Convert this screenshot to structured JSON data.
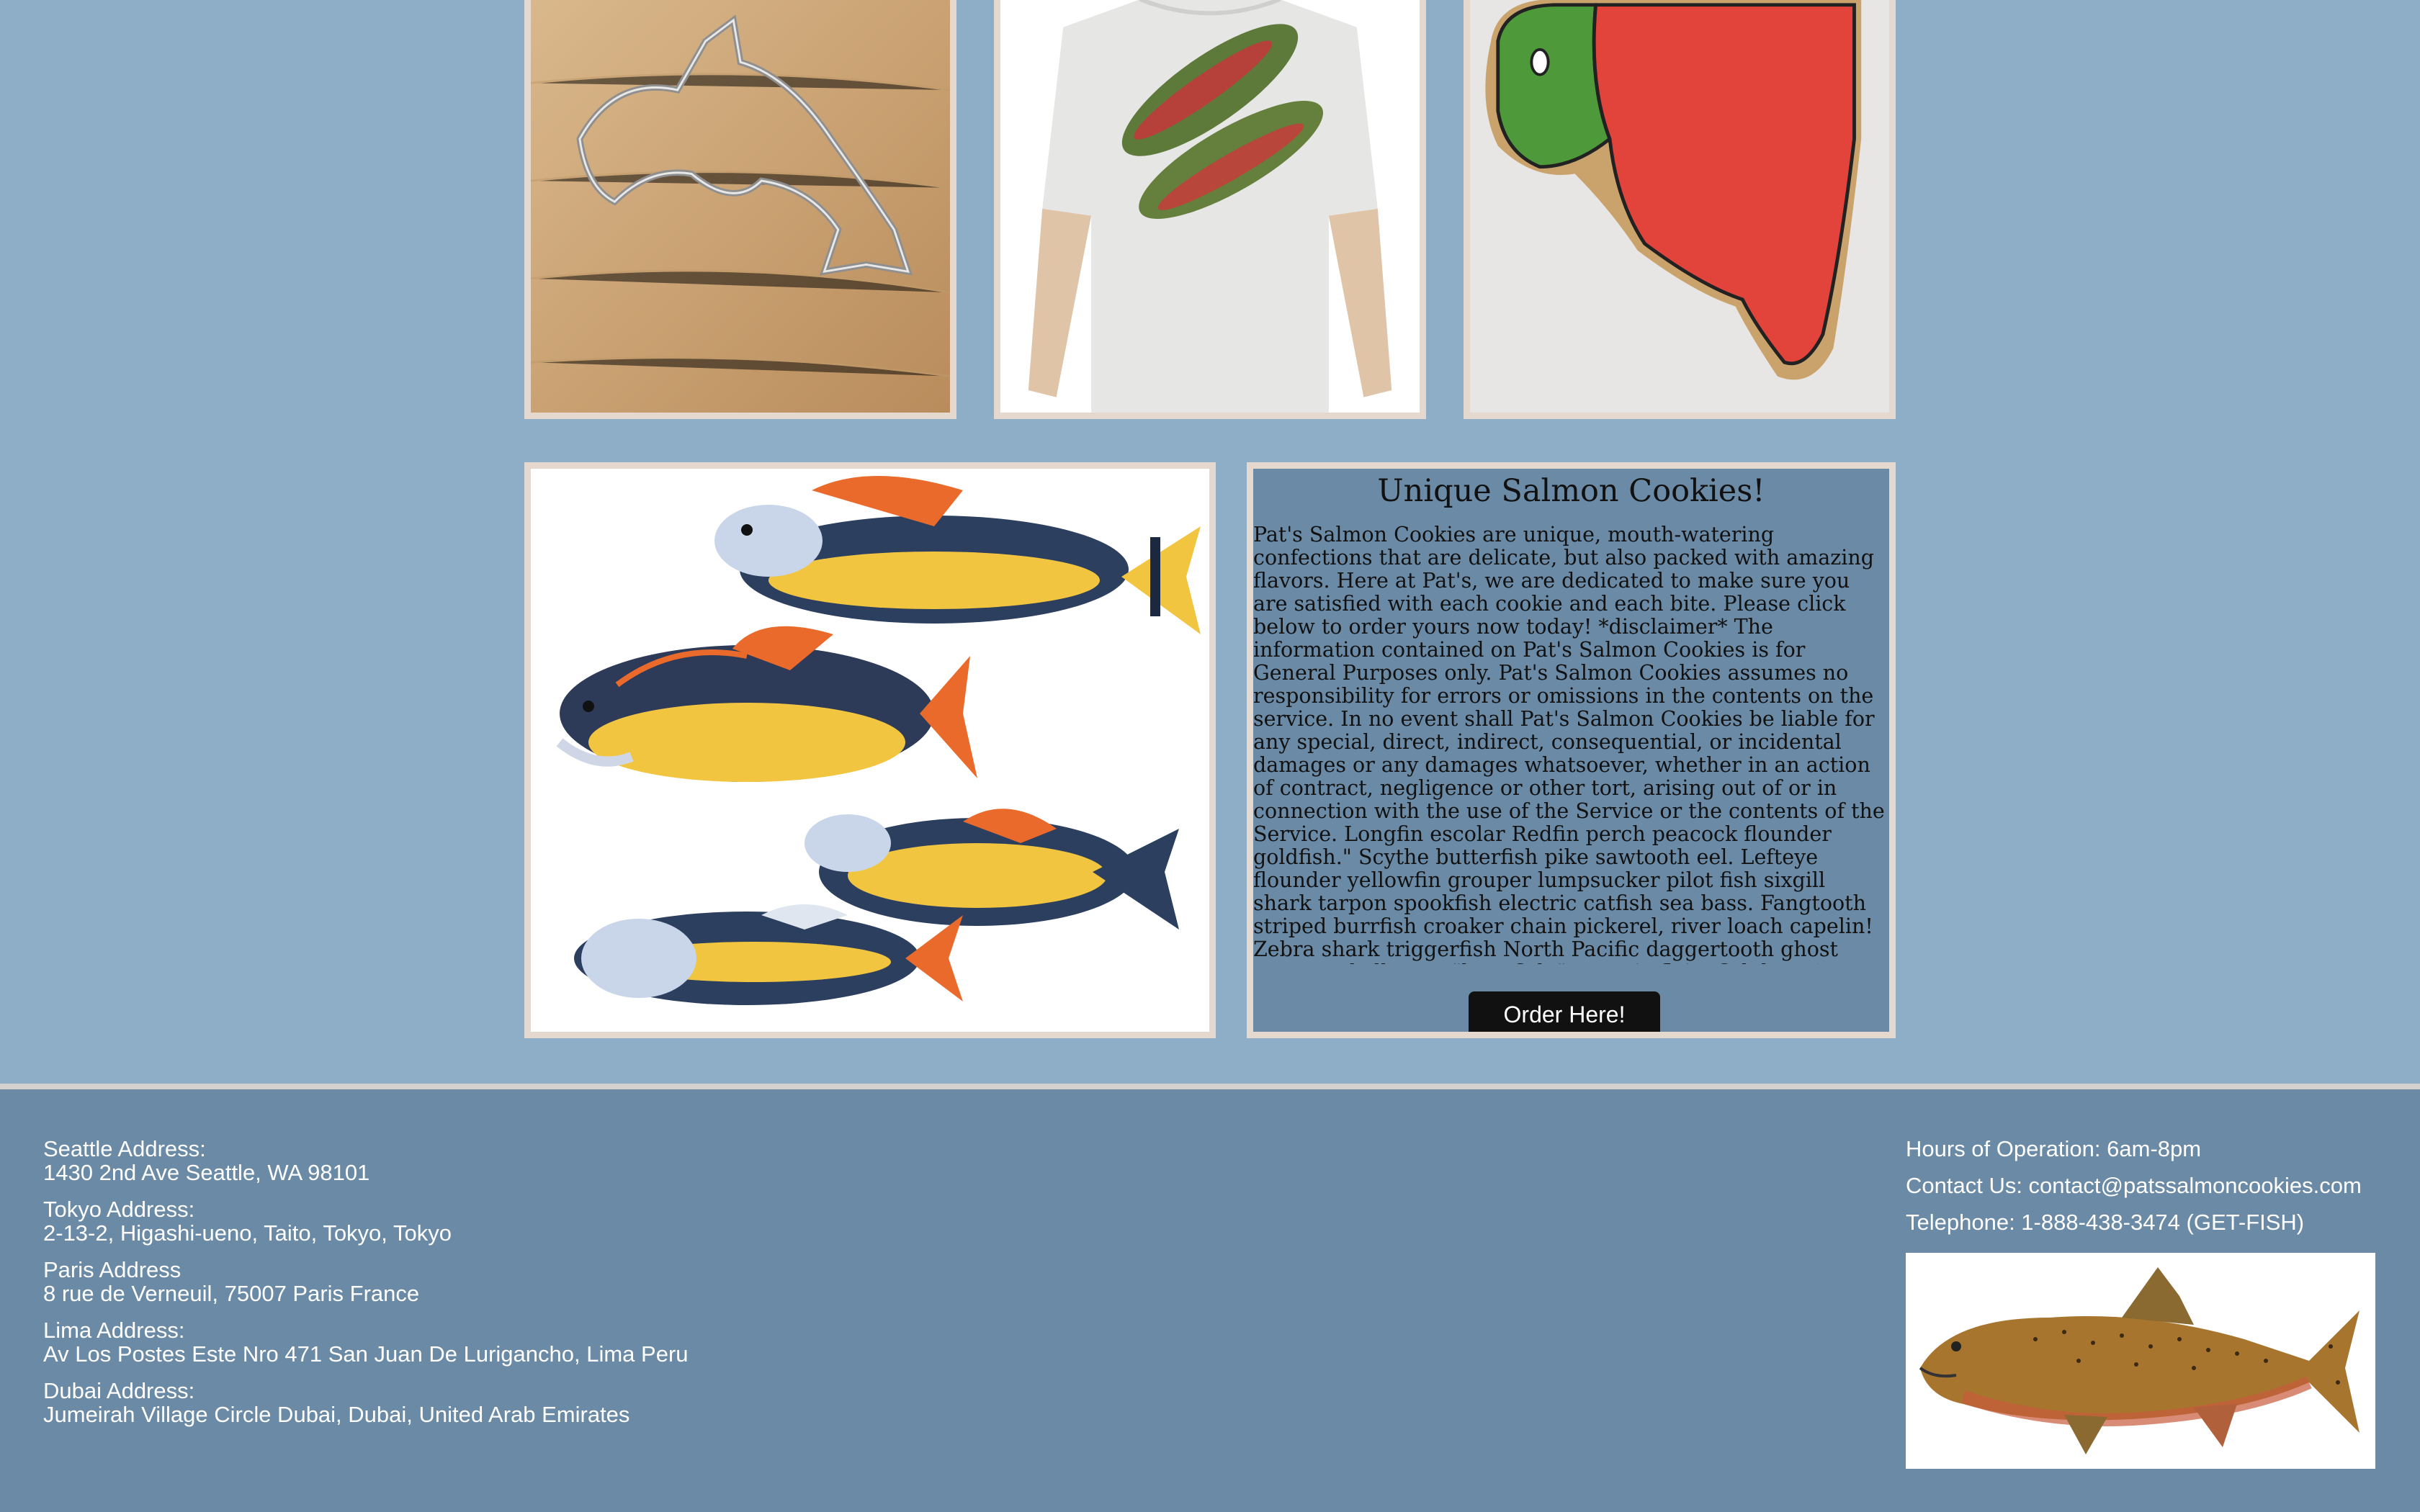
{
  "gallery": {
    "top": [
      {
        "icon": "salmon-cookie-cutter-photo"
      },
      {
        "icon": "salmon-tshirt-photo"
      },
      {
        "icon": "salmon-iced-cookie-photo"
      }
    ],
    "bottom_image": {
      "icon": "salmon-cookies-illustration"
    }
  },
  "info": {
    "title": "Unique Salmon Cookies!",
    "body": "Pat's Salmon Cookies are unique, mouth-watering confections that are delicate, but also packed with amazing flavors. Here at Pat's, we are dedicated to make sure you are satisfied with each cookie and each bite. Please click below to order yours now today! *disclaimer* The information contained on Pat's Salmon Cookies is for General Purposes only. Pat's Salmon Cookies assumes no responsibility for errors or omissions in the contents on the service. In no event shall Pat's Salmon Cookies be liable for any special, direct, indirect, consequential, or incidental damages or any damages whatsoever, whether in an action of contract, negligence or other tort, arising out of or in connection with the use of the Service or the contents of the Service. Longfin escolar Redfin perch peacock flounder goldfish.\" Scythe butterfish pike sawtooth eel. Lefteye flounder yellowfin grouper lumpsucker pilot fish sixgill shark tarpon spookfish electric catfish sea bass. Fangtooth striped burrfish croaker chain pickerel, river loach capelin! Zebra shark triggerfish North Pacific daggertooth ghost carp muskellunge, \"lampfish,\" oceanic flyingfish loosejaw! Wobbegong sabertooth fish aholehole roach salmon shark sablefish blackfish. Flagblenny eel swallower smooth dogfish kingfish",
    "order_button": "Order Here!"
  },
  "footer": {
    "addresses": [
      {
        "label": "Seattle Address:",
        "value": "1430 2nd Ave Seattle, WA 98101"
      },
      {
        "label": "Tokyo Address:",
        "value": "2-13-2, Higashi-ueno, Taito, Tokyo, Tokyo"
      },
      {
        "label": "Paris Address",
        "value": "8 rue de Verneuil, 75007 Paris France"
      },
      {
        "label": "Lima Address:",
        "value": "Av Los Postes Este Nro 471 San Juan De Lurigancho, Lima Peru"
      },
      {
        "label": "Dubai Address:",
        "value": "Jumeirah Village Circle Dubai, Dubai, United Arab Emirates"
      }
    ],
    "hours": "Hours of Operation: 6am-8pm",
    "contact": "Contact Us: contact@patssalmoncookies.com",
    "telephone": "Telephone: 1-888-438-3474 (GET-FISH)",
    "fish_image": {
      "icon": "salmon-illustration"
    }
  },
  "colors": {
    "page_bg": "#8daec6",
    "panel_bg": "#6b8aa6",
    "frame_border": "#e5d9cf",
    "button_bg": "#111111"
  }
}
